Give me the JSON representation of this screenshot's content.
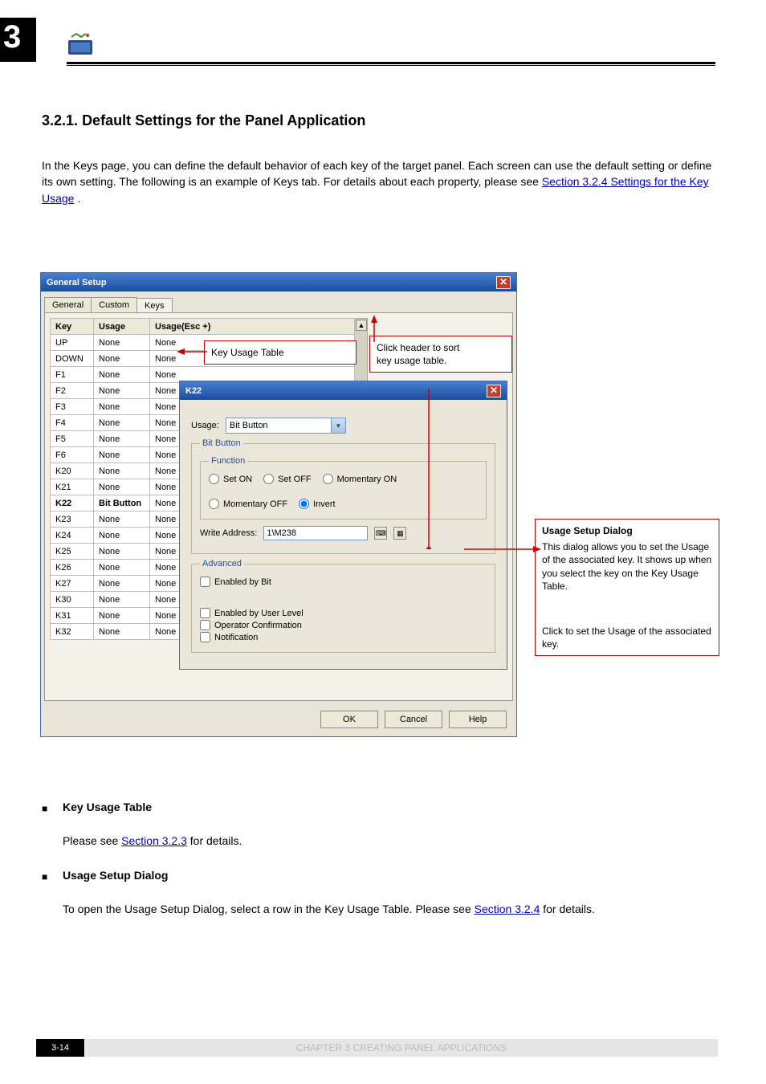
{
  "page": {
    "chapter_num": "3",
    "section_num": "3.2.1.",
    "section_title": "Default Settings for the Panel Application",
    "intro1": "In the Keys page, you can define the default behavior of each key of the target panel. Each screen can use the default setting or define its own setting. The following is an example of Keys tab. For details about each property, please see ",
    "intro1_link": "Section 3.2.4 Settings for the Key Usage",
    "intro1_after": ".",
    "table_head": "Key Usage Table",
    "table_body_before": "Please see ",
    "table_body_link": "Section 3.2.3",
    "table_body_after": " for details.",
    "usage_head": "Usage Setup Dialog",
    "usage_body_1": "To open the Usage Setup Dialog, select a row in the Key Usage Table. Please see ",
    "usage_body_link": "Section 3.2.4",
    "usage_body_2": " for details.",
    "footer_page": "3-14",
    "footer_label": "CHAPTER 3    CREATING PANEL APPLICATIONS"
  },
  "callout": {
    "top_left": "Key Usage Table",
    "top_right1": "Click header to sort",
    "top_right2": "key usage table.",
    "right_title": "Usage Setup Dialog",
    "right_body": "This dialog allows you to set the Usage of the associated key. It shows up when you select the key on the Key Usage Table.",
    "right_bottom": "Click to set the Usage of the associated key."
  },
  "dlg": {
    "title": "General Setup",
    "tabs": {
      "t1": "General",
      "t2": "Custom",
      "t3": "Keys"
    },
    "th": {
      "c1": "Key",
      "c2": "Usage",
      "c3": "Usage(Esc +)"
    },
    "rows": [
      {
        "k": "UP",
        "u": "None",
        "e": "None"
      },
      {
        "k": "DOWN",
        "u": "None",
        "e": "None"
      },
      {
        "k": "F1",
        "u": "None",
        "e": "None"
      },
      {
        "k": "F2",
        "u": "None",
        "e": "None"
      },
      {
        "k": "F3",
        "u": "None",
        "e": "None"
      },
      {
        "k": "F4",
        "u": "None",
        "e": "None"
      },
      {
        "k": "F5",
        "u": "None",
        "e": "None"
      },
      {
        "k": "F6",
        "u": "None",
        "e": "None"
      },
      {
        "k": "K20",
        "u": "None",
        "e": "None"
      },
      {
        "k": "K21",
        "u": "None",
        "e": "None"
      },
      {
        "k": "K22",
        "u": "Bit Button",
        "e": "None",
        "sel": true
      },
      {
        "k": "K23",
        "u": "None",
        "e": "None"
      },
      {
        "k": "K24",
        "u": "None",
        "e": "None"
      },
      {
        "k": "K25",
        "u": "None",
        "e": "None"
      },
      {
        "k": "K26",
        "u": "None",
        "e": "None"
      },
      {
        "k": "K27",
        "u": "None",
        "e": "None"
      },
      {
        "k": "K30",
        "u": "None",
        "e": "None"
      },
      {
        "k": "K31",
        "u": "None",
        "e": "None"
      },
      {
        "k": "K32",
        "u": "None",
        "e": "None"
      }
    ],
    "ok": "OK",
    "cancel": "Cancel",
    "help": "Help"
  },
  "k22": {
    "title": "K22",
    "usage_label": "Usage:",
    "usage_value": "Bit Button",
    "group": "Bit Button",
    "func_legend": "Function",
    "r1": "Set ON",
    "r2": "Set OFF",
    "r3": "Momentary ON",
    "r4": "Momentary OFF",
    "r5": "Invert",
    "wa_label": "Write Address:",
    "wa_value": "1\\M238",
    "adv_legend": "Advanced",
    "enabled_bit": "Enabled by Bit",
    "enabled_user": "Enabled by User Level",
    "op_conf": "Operator Confirmation",
    "notif": "Notification"
  }
}
